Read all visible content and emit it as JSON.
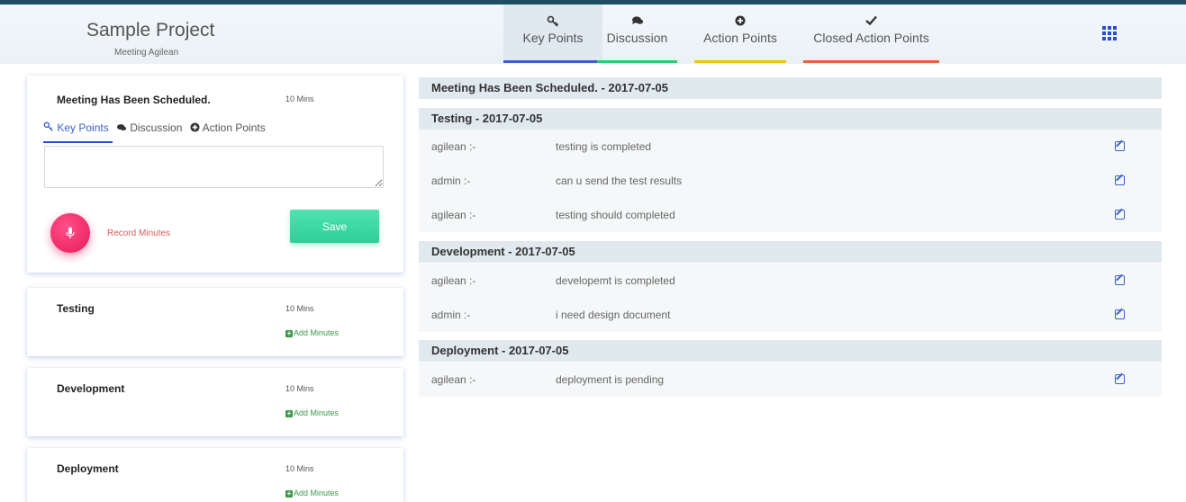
{
  "header": {
    "project_title": "Sample Project",
    "project_subtitle": "Meeting Agilean",
    "tabs": [
      {
        "label": "Key Points",
        "icon": "key-icon",
        "color": "#3f5bd8"
      },
      {
        "label": "Discussion",
        "icon": "comments-icon",
        "color": "#2ecc71"
      },
      {
        "label": "Action Points",
        "icon": "plus-circle-icon",
        "color": "#f1c40f"
      },
      {
        "label": "Closed Action Points",
        "icon": "check-icon",
        "color": "#e8603c"
      }
    ],
    "apps_icon": "grid-icon"
  },
  "cards": [
    {
      "title": "Meeting Has Been Scheduled.",
      "mins": "10 Mins",
      "subtabs": [
        "Key Points",
        "Discussion",
        "Action Points"
      ],
      "textarea_value": "",
      "record_label": "Record Minutes",
      "save_label": "Save"
    },
    {
      "title": "Testing",
      "mins": "10 Mins",
      "add_label": "Add Minutes"
    },
    {
      "title": "Development",
      "mins": "10 Mins",
      "add_label": "Add Minutes"
    },
    {
      "title": "Deployment",
      "mins": "10 Mins",
      "add_label": "Add Minutes"
    }
  ],
  "minutes": {
    "sections": [
      {
        "title": "Meeting Has Been Scheduled. - 2017-07-05",
        "entries": []
      },
      {
        "title": "Testing - 2017-07-05",
        "entries": [
          {
            "user": "agilean :-",
            "text": "testing is completed"
          },
          {
            "user": "admin :-",
            "text": "can u send the test results"
          },
          {
            "user": "agilean :-",
            "text": "testing should completed"
          }
        ]
      },
      {
        "title": "Development - 2017-07-05",
        "entries": [
          {
            "user": "agilean :-",
            "text": "developemt is completed"
          },
          {
            "user": "admin :-",
            "text": "i need design document"
          }
        ]
      },
      {
        "title": "Deployment - 2017-07-05",
        "entries": [
          {
            "user": "agilean :-",
            "text": "deployment is pending"
          }
        ]
      }
    ]
  }
}
